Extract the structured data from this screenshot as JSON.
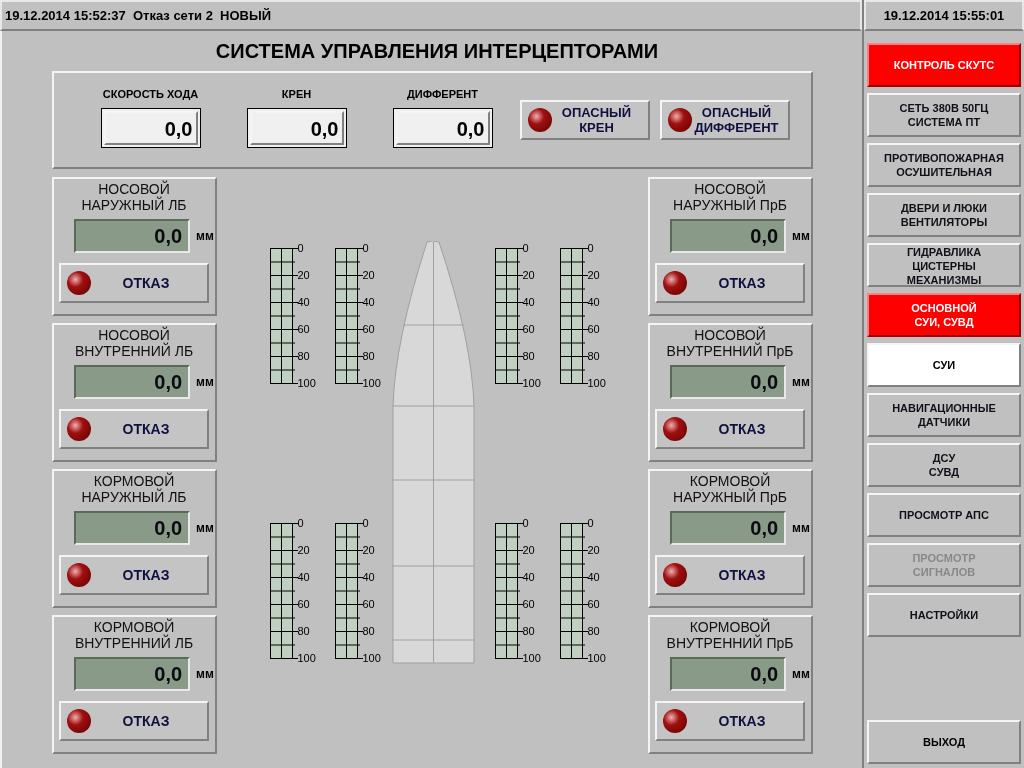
{
  "status_bar": {
    "event": "19.12.2014 15:52:37  Отказ сети 2  НОВЫЙ",
    "clock": "19.12.2014 15:55:01"
  },
  "title": "СИСТЕМА УПРАВЛЕНИЯ ИНТЕРЦЕПТОРАМИ",
  "indicators": [
    {
      "label": "СКОРОСТЬ ХОДА",
      "value": "0,0"
    },
    {
      "label": "КРЕН",
      "value": "0,0"
    },
    {
      "label": "ДИФФЕРЕНТ",
      "value": "0,0"
    }
  ],
  "alarm_buttons": [
    {
      "label": "ОПАСНЫЙ\nКРЕН",
      "lamp_on": false
    },
    {
      "label": "ОПАСНЫЙ\nДИФФЕРЕНТ",
      "lamp_on": false
    }
  ],
  "left_panels": [
    {
      "title": "НОСОВОЙ\nНАРУЖНЫЙ ЛБ",
      "value": "0,0",
      "unit": "мм",
      "fault_label": "ОТКАЗ",
      "lamp_on": false
    },
    {
      "title": "НОСОВОЙ\nВНУТРЕННИЙ ЛБ",
      "value": "0,0",
      "unit": "мм",
      "fault_label": "ОТКАЗ",
      "lamp_on": false
    },
    {
      "title": "КОРМОВОЙ\nНАРУЖНЫЙ ЛБ",
      "value": "0,0",
      "unit": "мм",
      "fault_label": "ОТКАЗ",
      "lamp_on": false
    },
    {
      "title": "КОРМОВОЙ\nВНУТРЕННИЙ ЛБ",
      "value": "0,0",
      "unit": "мм",
      "fault_label": "ОТКАЗ",
      "lamp_on": false
    }
  ],
  "right_panels": [
    {
      "title": "НОСОВОЙ\nНАРУЖНЫЙ ПрБ",
      "value": "0,0",
      "unit": "мм",
      "fault_label": "ОТКАЗ",
      "lamp_on": false
    },
    {
      "title": "НОСОВОЙ\nВНУТРЕННИЙ ПрБ",
      "value": "0,0",
      "unit": "мм",
      "fault_label": "ОТКАЗ",
      "lamp_on": false
    },
    {
      "title": "КОРМОВОЙ\nНАРУЖНЫЙ ПрБ",
      "value": "0,0",
      "unit": "мм",
      "fault_label": "ОТКАЗ",
      "lamp_on": false
    },
    {
      "title": "КОРМОВОЙ\nВНУТРЕННИЙ ПрБ",
      "value": "0,0",
      "unit": "мм",
      "fault_label": "ОТКАЗ",
      "lamp_on": false
    }
  ],
  "gauges": [
    {
      "scale": [
        "0",
        "20",
        "40",
        "60",
        "80",
        "100"
      ]
    },
    {
      "scale": [
        "0",
        "20",
        "40",
        "60",
        "80",
        "100"
      ]
    },
    {
      "scale": [
        "0",
        "20",
        "40",
        "60",
        "80",
        "100"
      ]
    },
    {
      "scale": [
        "0",
        "20",
        "40",
        "60",
        "80",
        "100"
      ]
    },
    {
      "scale": [
        "0",
        "20",
        "40",
        "60",
        "80",
        "100"
      ]
    },
    {
      "scale": [
        "0",
        "20",
        "40",
        "60",
        "80",
        "100"
      ]
    },
    {
      "scale": [
        "0",
        "20",
        "40",
        "60",
        "80",
        "100"
      ]
    },
    {
      "scale": [
        "0",
        "20",
        "40",
        "60",
        "80",
        "100"
      ]
    }
  ],
  "sidebar": {
    "items": [
      {
        "label": "КОНТРОЛЬ СКУТС",
        "alarm": true,
        "selected": false,
        "disabled": false
      },
      {
        "label": "СЕТЬ 380В 50ГЦ\nСИСТЕМА ПТ",
        "alarm": false,
        "selected": false,
        "disabled": false
      },
      {
        "label": "ПРОТИВОПОЖАРНАЯ\nОСУШИТЕЛЬНАЯ",
        "alarm": false,
        "selected": false,
        "disabled": false
      },
      {
        "label": "ДВЕРИ И ЛЮКИ\nВЕНТИЛЯТОРЫ",
        "alarm": false,
        "selected": false,
        "disabled": false
      },
      {
        "label": "ГИДРАВЛИКА\nЦИСТЕРНЫ\nМЕХАНИЗМЫ",
        "alarm": false,
        "selected": false,
        "disabled": false
      },
      {
        "label": "ОСНОВНОЙ\nСУИ, СУВД",
        "alarm": true,
        "selected": false,
        "disabled": false
      },
      {
        "label": "СУИ",
        "alarm": false,
        "selected": true,
        "disabled": false
      },
      {
        "label": "НАВИГАЦИОННЫЕ\nДАТЧИКИ",
        "alarm": false,
        "selected": false,
        "disabled": false
      },
      {
        "label": "ДСУ\nСУВД",
        "alarm": false,
        "selected": false,
        "disabled": false
      },
      {
        "label": "ПРОСМОТР АПС",
        "alarm": false,
        "selected": false,
        "disabled": false
      },
      {
        "label": "ПРОСМОТР\nСИГНАЛОВ",
        "alarm": false,
        "selected": false,
        "disabled": true
      },
      {
        "label": "НАСТРОЙКИ",
        "alarm": false,
        "selected": false,
        "disabled": false
      }
    ],
    "exit": "ВЫХОД"
  }
}
